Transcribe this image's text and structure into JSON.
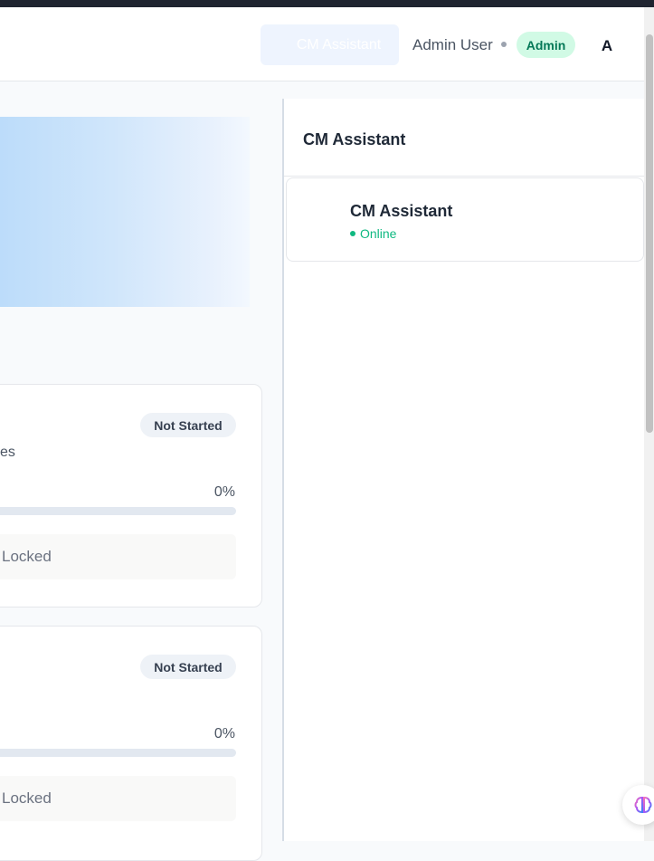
{
  "header": {
    "assistant_button_label": "CM Assistant",
    "user_name": "Admin User",
    "role_badge": "Admin",
    "avatar_initial": "A"
  },
  "modules": [
    {
      "status": "Not Started",
      "subtitle_fragment": "es",
      "progress_label": "0%",
      "progress_value": 0,
      "lock_label": "Locked"
    },
    {
      "status": "Not Started",
      "progress_label": "0%",
      "progress_value": 0,
      "lock_label": "Locked"
    }
  ],
  "chat": {
    "panel_title": "CM Assistant",
    "assistant_name": "CM Assistant",
    "status": "Online"
  },
  "icons": {
    "fab": "brain-icon",
    "online_indicator": "status-dot-icon"
  },
  "colors": {
    "accent_green": "#10b981",
    "admin_badge_bg": "#d1fae5",
    "assistant_button_bg": "#eef4fe",
    "hero_gradient_start": "#bcdcfa"
  }
}
